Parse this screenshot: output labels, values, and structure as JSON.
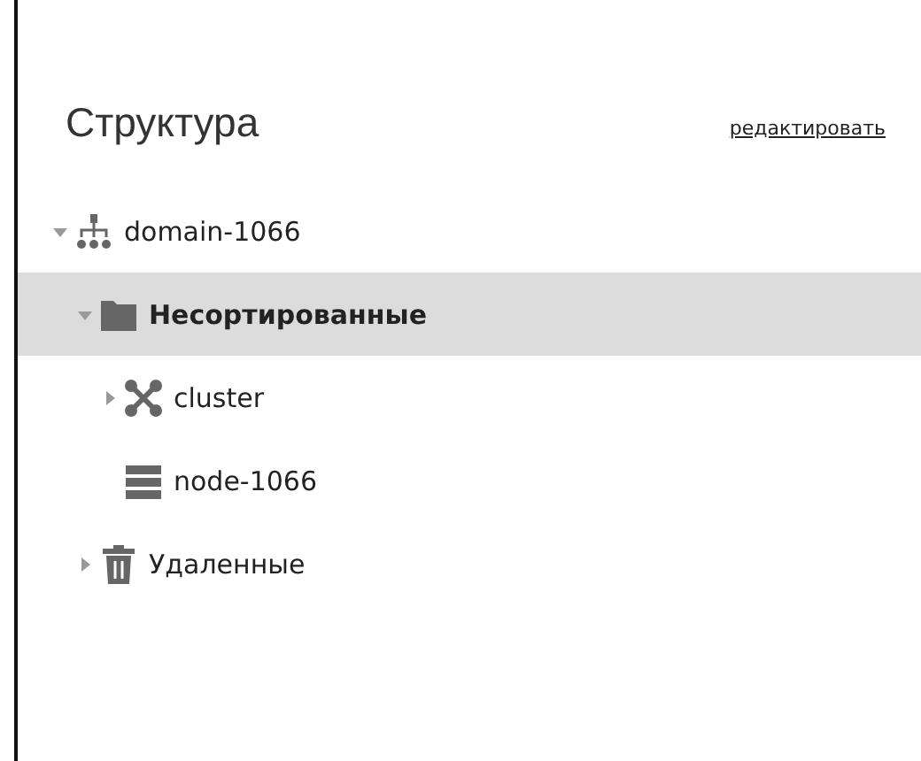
{
  "panel": {
    "title": "Структура",
    "edit_link": "редактировать"
  },
  "tree": [
    {
      "label": "domain-1066",
      "kind": "domain",
      "expanded": true,
      "selected": false,
      "children": [
        {
          "label": "Несортированные",
          "kind": "folder",
          "expanded": true,
          "selected": true,
          "children": [
            {
              "label": "cluster",
              "kind": "cluster",
              "expanded": false,
              "selected": false
            },
            {
              "label": "node-1066",
              "kind": "server",
              "selected": false
            }
          ]
        },
        {
          "label": "Удаленные",
          "kind": "trash",
          "expanded": false,
          "selected": false
        }
      ]
    }
  ]
}
